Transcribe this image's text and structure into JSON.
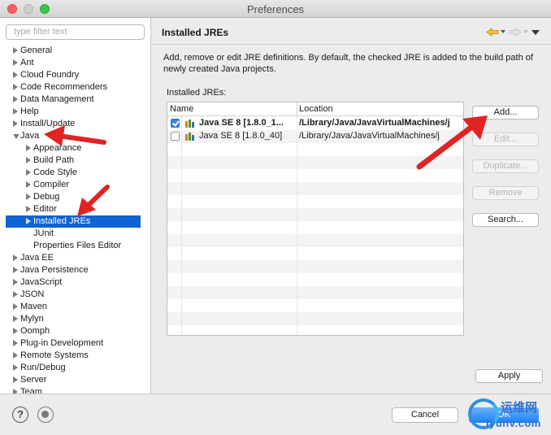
{
  "window": {
    "title": "Preferences"
  },
  "sidebar": {
    "filter_placeholder": "type filter text",
    "items": [
      {
        "label": "General",
        "twisty": "closed"
      },
      {
        "label": "Ant",
        "twisty": "closed"
      },
      {
        "label": "Cloud Foundry",
        "twisty": "closed"
      },
      {
        "label": "Code Recommenders",
        "twisty": "closed"
      },
      {
        "label": "Data Management",
        "twisty": "closed"
      },
      {
        "label": "Help",
        "twisty": "closed"
      },
      {
        "label": "Install/Update",
        "twisty": "closed"
      },
      {
        "label": "Java",
        "twisty": "open"
      },
      {
        "label": "Appearance",
        "twisty": "closed",
        "child": true
      },
      {
        "label": "Build Path",
        "twisty": "closed",
        "child": true
      },
      {
        "label": "Code Style",
        "twisty": "closed",
        "child": true
      },
      {
        "label": "Compiler",
        "twisty": "closed",
        "child": true
      },
      {
        "label": "Debug",
        "twisty": "closed",
        "child": true
      },
      {
        "label": "Editor",
        "twisty": "closed",
        "child": true
      },
      {
        "label": "Installed JREs",
        "twisty": "closed",
        "child": true,
        "selected": true
      },
      {
        "label": "JUnit",
        "twisty": "none",
        "child": true
      },
      {
        "label": "Properties Files Editor",
        "twisty": "none",
        "child": true
      },
      {
        "label": "Java EE",
        "twisty": "closed"
      },
      {
        "label": "Java Persistence",
        "twisty": "closed"
      },
      {
        "label": "JavaScript",
        "twisty": "closed"
      },
      {
        "label": "JSON",
        "twisty": "closed"
      },
      {
        "label": "Maven",
        "twisty": "closed"
      },
      {
        "label": "Mylyn",
        "twisty": "closed"
      },
      {
        "label": "Oomph",
        "twisty": "closed"
      },
      {
        "label": "Plug-in Development",
        "twisty": "closed"
      },
      {
        "label": "Remote Systems",
        "twisty": "closed"
      },
      {
        "label": "Run/Debug",
        "twisty": "closed"
      },
      {
        "label": "Server",
        "twisty": "closed"
      },
      {
        "label": "Team",
        "twisty": "closed"
      }
    ]
  },
  "page": {
    "title": "Installed JREs",
    "description": "Add, remove or edit JRE definitions. By default, the checked JRE is added to the build path of newly created Java projects.",
    "list_label": "Installed JREs:",
    "table": {
      "columns": [
        "Name",
        "Location"
      ],
      "rows": [
        {
          "name": "Java SE 8 [1.8.0_1...",
          "location": "/Library/Java/JavaVirtualMachines/j",
          "checked": true,
          "bold": true
        },
        {
          "name": "Java SE 8 [1.8.0_40]",
          "location": "/Library/Java/JavaVirtualMachines/j",
          "checked": false,
          "bold": false
        }
      ]
    },
    "buttons": {
      "add": "Add...",
      "edit": "Edit...",
      "duplicate": "Duplicate...",
      "remove": "Remove",
      "search": "Search...",
      "apply": "Apply"
    }
  },
  "footer": {
    "help_glyph": "?",
    "cancel": "Cancel",
    "ok": "OK"
  },
  "watermark": {
    "cn": "运维网",
    "en": "iyunv.com"
  },
  "colors": {
    "selection": "#0f63d4",
    "annotation_arrow": "#e02424",
    "ok_button": "#1d7ff5"
  }
}
